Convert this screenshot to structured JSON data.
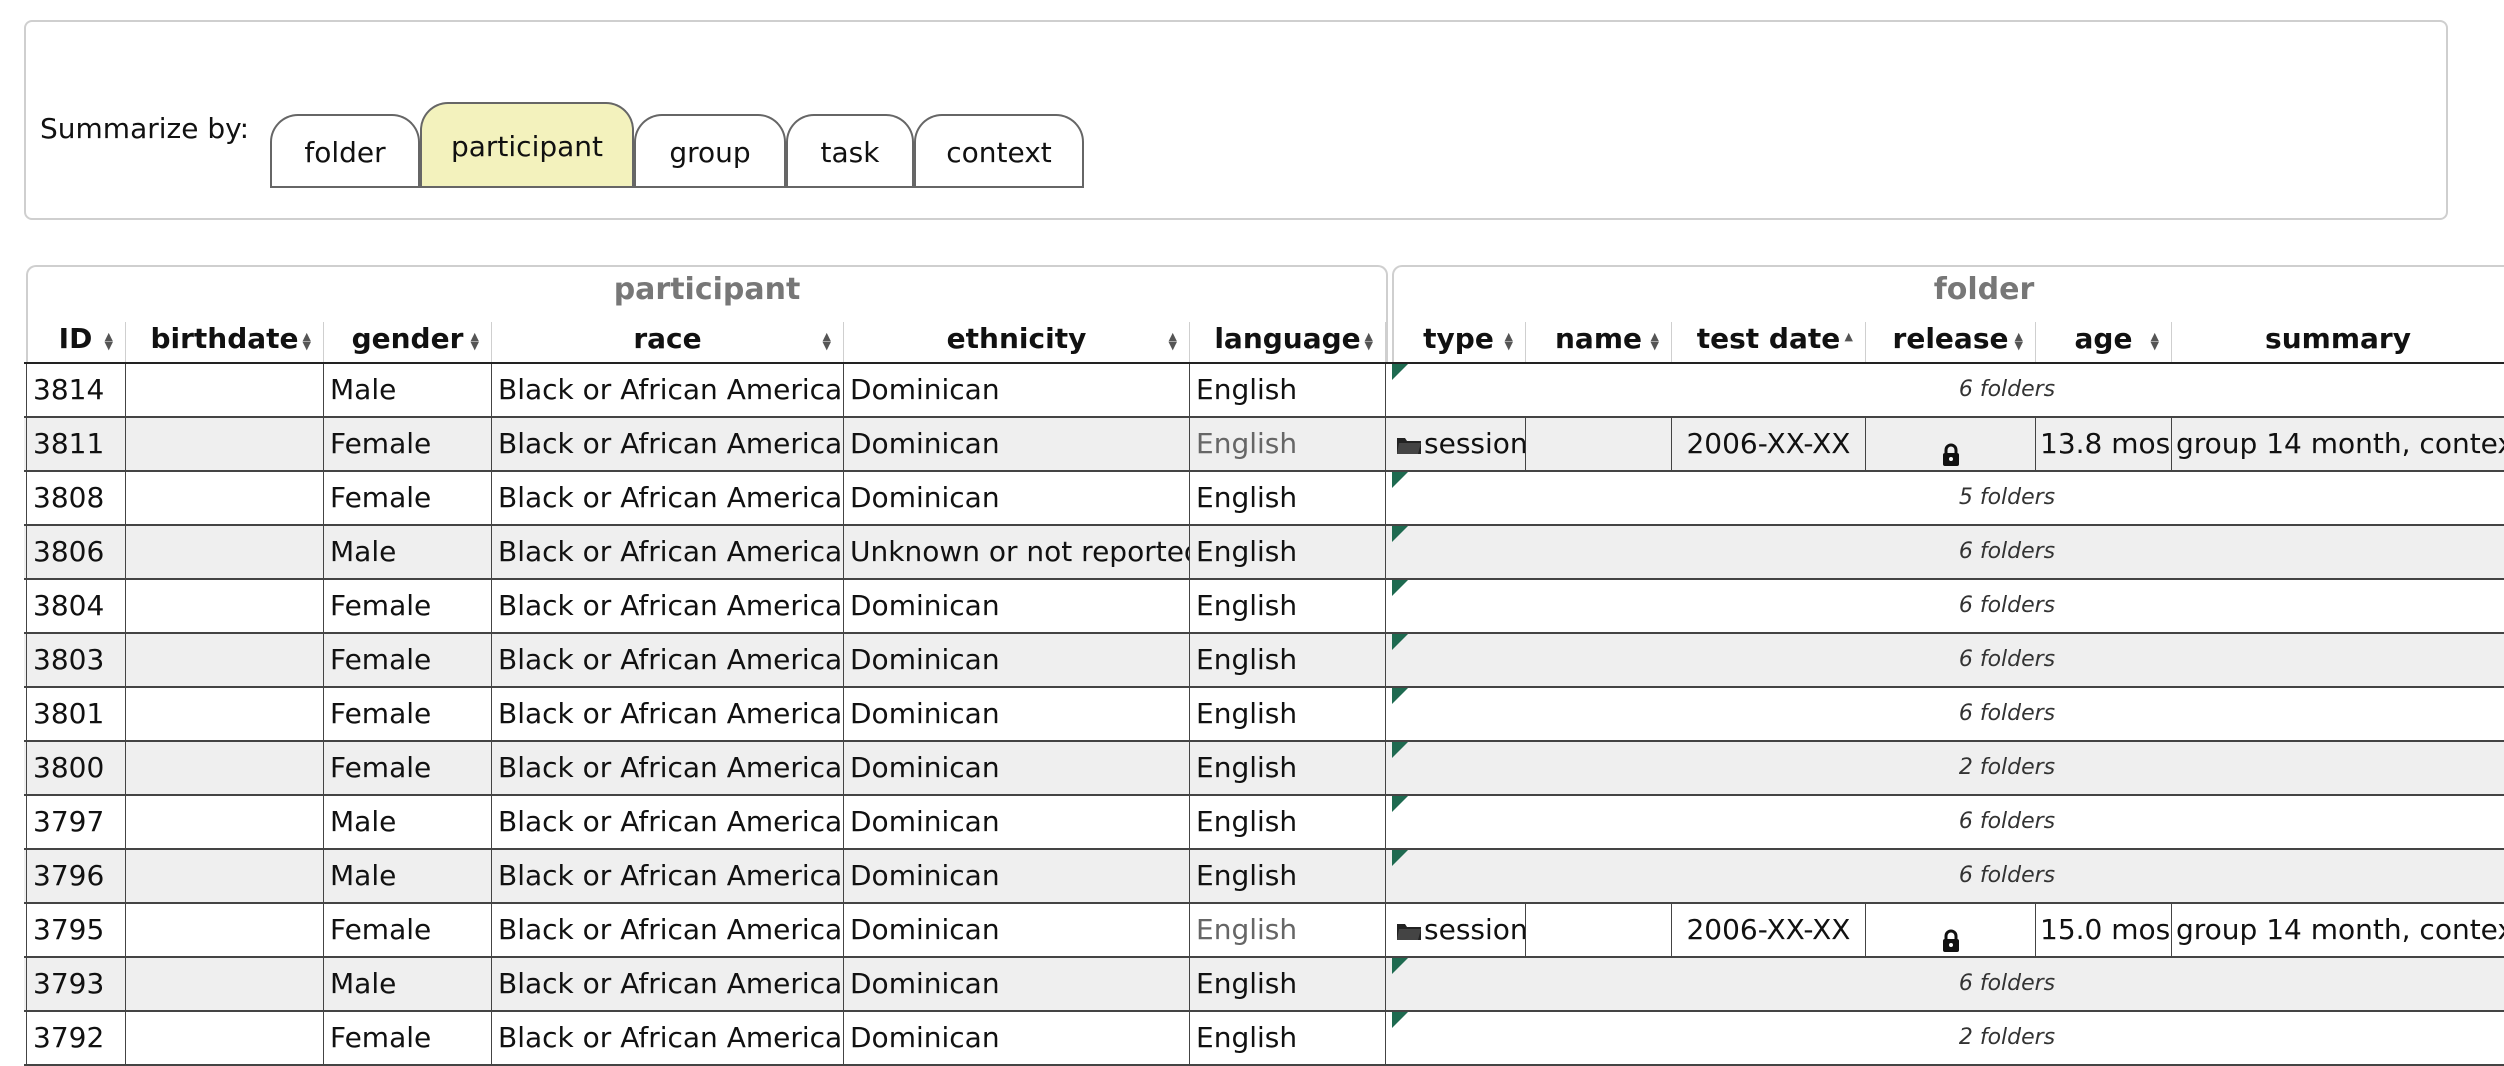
{
  "summarize": {
    "label": "Summarize by:",
    "tabs": [
      {
        "label": "folder",
        "active": false
      },
      {
        "label": "participant",
        "active": true
      },
      {
        "label": "group",
        "active": false
      },
      {
        "label": "task",
        "active": false
      },
      {
        "label": "context",
        "active": false
      }
    ]
  },
  "groups": {
    "participant": "participant",
    "folder": "folder"
  },
  "columns": {
    "participant": [
      "ID",
      "birthdate",
      "gender",
      "race",
      "ethnicity",
      "language"
    ],
    "folder": [
      "type",
      "name",
      "test date",
      "release",
      "age",
      "summary"
    ]
  },
  "rows": [
    {
      "id": "3814",
      "birthdate": "",
      "gender": "Male",
      "race": "Black or African American",
      "ethnicity": "Dominican",
      "language": "English",
      "folders": "6 folders"
    },
    {
      "id": "3811",
      "birthdate": "",
      "gender": "Female",
      "race": "Black or African American",
      "ethnicity": "Dominican",
      "language": "English",
      "folder": {
        "type": "session",
        "name": "",
        "test_date": "2006-XX-XX",
        "release": "lock",
        "age": "13.8 mos",
        "summary": "group 14 month, contex"
      }
    },
    {
      "id": "3808",
      "birthdate": "",
      "gender": "Female",
      "race": "Black or African American",
      "ethnicity": "Dominican",
      "language": "English",
      "folders": "5 folders"
    },
    {
      "id": "3806",
      "birthdate": "",
      "gender": "Male",
      "race": "Black or African American",
      "ethnicity": "Unknown or not reported",
      "language": "English",
      "folders": "6 folders"
    },
    {
      "id": "3804",
      "birthdate": "",
      "gender": "Female",
      "race": "Black or African American",
      "ethnicity": "Dominican",
      "language": "English",
      "folders": "6 folders"
    },
    {
      "id": "3803",
      "birthdate": "",
      "gender": "Female",
      "race": "Black or African American",
      "ethnicity": "Dominican",
      "language": "English",
      "folders": "6 folders"
    },
    {
      "id": "3801",
      "birthdate": "",
      "gender": "Female",
      "race": "Black or African American",
      "ethnicity": "Dominican",
      "language": "English",
      "folders": "6 folders"
    },
    {
      "id": "3800",
      "birthdate": "",
      "gender": "Female",
      "race": "Black or African American",
      "ethnicity": "Dominican",
      "language": "English",
      "folders": "2 folders"
    },
    {
      "id": "3797",
      "birthdate": "",
      "gender": "Male",
      "race": "Black or African American",
      "ethnicity": "Dominican",
      "language": "English",
      "folders": "6 folders"
    },
    {
      "id": "3796",
      "birthdate": "",
      "gender": "Male",
      "race": "Black or African American",
      "ethnicity": "Dominican",
      "language": "English",
      "folders": "6 folders"
    },
    {
      "id": "3795",
      "birthdate": "",
      "gender": "Female",
      "race": "Black or African American",
      "ethnicity": "Dominican",
      "language": "English",
      "folder": {
        "type": "session",
        "name": "",
        "test_date": "2006-XX-XX",
        "release": "lock",
        "age": "15.0 mos",
        "summary": "group 14 month, contex"
      }
    },
    {
      "id": "3793",
      "birthdate": "",
      "gender": "Male",
      "race": "Black or African American",
      "ethnicity": "Dominican",
      "language": "English",
      "folders": "6 folders"
    },
    {
      "id": "3792",
      "birthdate": "",
      "gender": "Female",
      "race": "Black or African American",
      "ethnicity": "Dominican",
      "language": "English",
      "folders": "2 folders"
    }
  ]
}
